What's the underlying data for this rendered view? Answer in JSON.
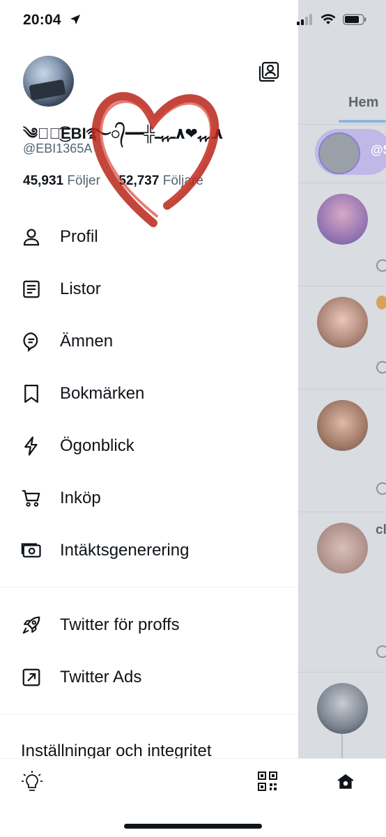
{
  "status_bar": {
    "time": "20:04"
  },
  "profile": {
    "display_name": "༄ঔৣ͜͡EBI࿐᭄━━╬٨ـﮩﮩ❤٨ـﮩﮩـ",
    "handle": "@EBI1365A",
    "following_count": "45,931",
    "following_label": "Följer",
    "followers_count": "52,737",
    "followers_label": "Följare"
  },
  "menu": {
    "items": [
      {
        "label": "Profil",
        "icon": "person-icon"
      },
      {
        "label": "Listor",
        "icon": "list-icon"
      },
      {
        "label": "Ämnen",
        "icon": "topics-icon"
      },
      {
        "label": "Bokmärken",
        "icon": "bookmark-icon"
      },
      {
        "label": "Ögonblick",
        "icon": "lightning-icon"
      },
      {
        "label": "Inköp",
        "icon": "cart-icon"
      },
      {
        "label": "Intäktsgenerering",
        "icon": "money-icon"
      }
    ],
    "secondary": [
      {
        "label": "Twitter för proffs",
        "icon": "rocket-icon"
      },
      {
        "label": "Twitter Ads",
        "icon": "external-arrow-icon"
      }
    ],
    "settings_label": "Inställningar och integritet"
  },
  "timeline": {
    "tab_label": "Hem",
    "banner_text": "@S",
    "author_fragment": "cl"
  }
}
